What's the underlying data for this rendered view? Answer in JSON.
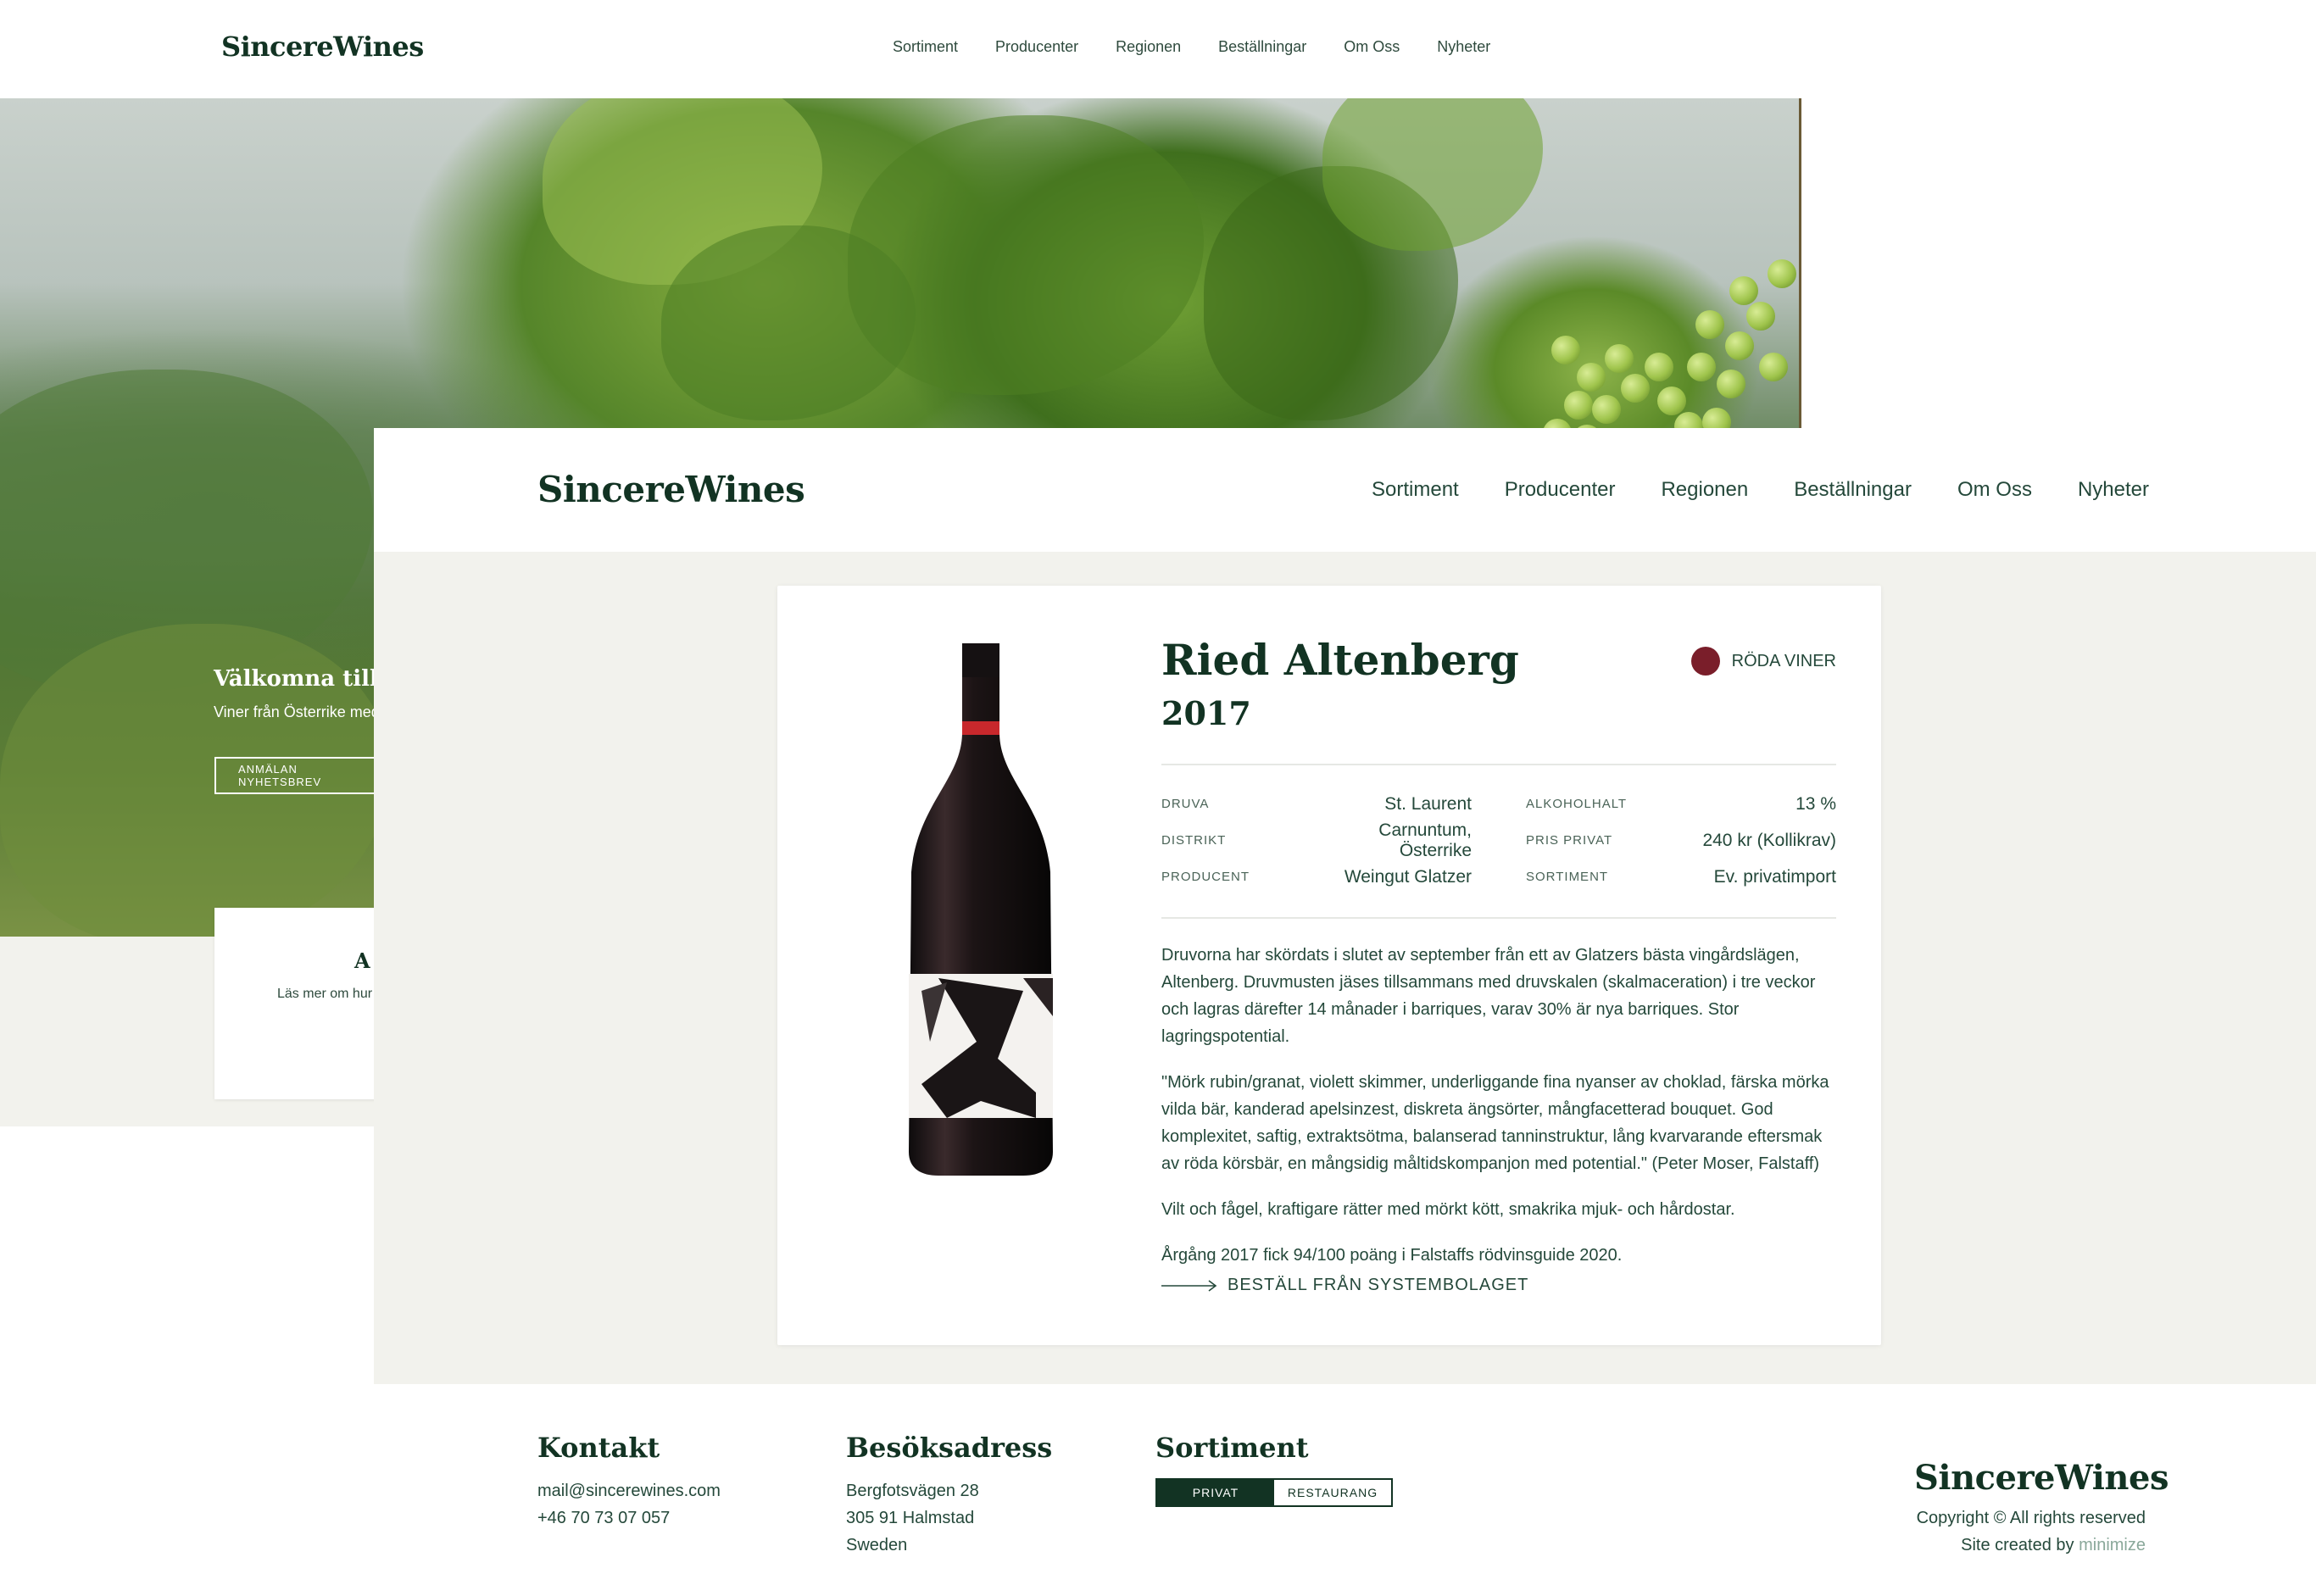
{
  "brand": "SincereWines",
  "nav": [
    "Sortiment",
    "Producenter",
    "Regionen",
    "Beställningar",
    "Om Oss",
    "Nyheter"
  ],
  "background_page": {
    "welcome_title": "Välkomna till Si",
    "welcome_subtitle": "Viner från Österrike med",
    "newsletter_button": "ANMÄLAN NYHETSBREV",
    "card_title": "A",
    "card_text": "Läs mer om hur"
  },
  "product": {
    "name": "Ried Altenberg",
    "year": "2017",
    "type_label": "RÖDA VINER",
    "type_color": "#7a1e2a",
    "specs": [
      [
        {
          "label": "DRUVA",
          "value": "St. Laurent"
        },
        {
          "label": "ALKOHOLHALT",
          "value": "13 %"
        }
      ],
      [
        {
          "label": "DISTRIKT",
          "value": "Carnuntum, Österrike"
        },
        {
          "label": "PRIS PRIVAT",
          "value": "240 kr (Kollikrav)"
        }
      ],
      [
        {
          "label": "PRODUCENT",
          "value": "Weingut Glatzer"
        },
        {
          "label": "SORTIMENT",
          "value": "Ev. privatimport"
        }
      ]
    ],
    "description": [
      "Druvorna har skördats i slutet av september från ett av Glatzers bästa vingårdslägen, Altenberg. Druvmusten jäses tillsammans med druvskalen (skalmaceration) i tre veckor och lagras därefter 14 månader i barriques, varav 30% är nya barriques. Stor lagringspotential.",
      "\"Mörk rubin/granat, violett skimmer, underliggande fina nyanser av choklad, färska mörka vilda bär, kanderad apelsinzest, diskreta ängsörter, mångfacetterad bouquet. God komplexitet, saftig, extraktsötma, balanserad tanninstruktur, lång kvarvarande eftersmak av röda körsbär, en mångsidig måltidskompanjon med potential.\" (Peter Moser, Falstaff)",
      "Vilt och fågel, kraftigare rätter med mörkt kött, smakrika mjuk- och hårdostar.",
      "Årgång 2017 fick 94/100 poäng i Falstaffs rödvinsguide 2020."
    ],
    "order_link": "BESTÄLL FRÅN SYSTEMBOLAGET"
  },
  "footer": {
    "contact_title": "Kontakt",
    "email": "mail@sincerewines.com",
    "phone": "+46 70 73 07 057",
    "address_title": "Besöksadress",
    "address": [
      "Bergfotsvägen 28",
      "305 91 Halmstad",
      "Sweden"
    ],
    "sortiment_title": "Sortiment",
    "toggle_privat": "PRIVAT",
    "toggle_restaurang": "RESTAURANG",
    "logo": "SincereWines",
    "copyright": "Copyright © All rights reserved",
    "created_prefix": "Site created by",
    "created_link": "minimize"
  }
}
